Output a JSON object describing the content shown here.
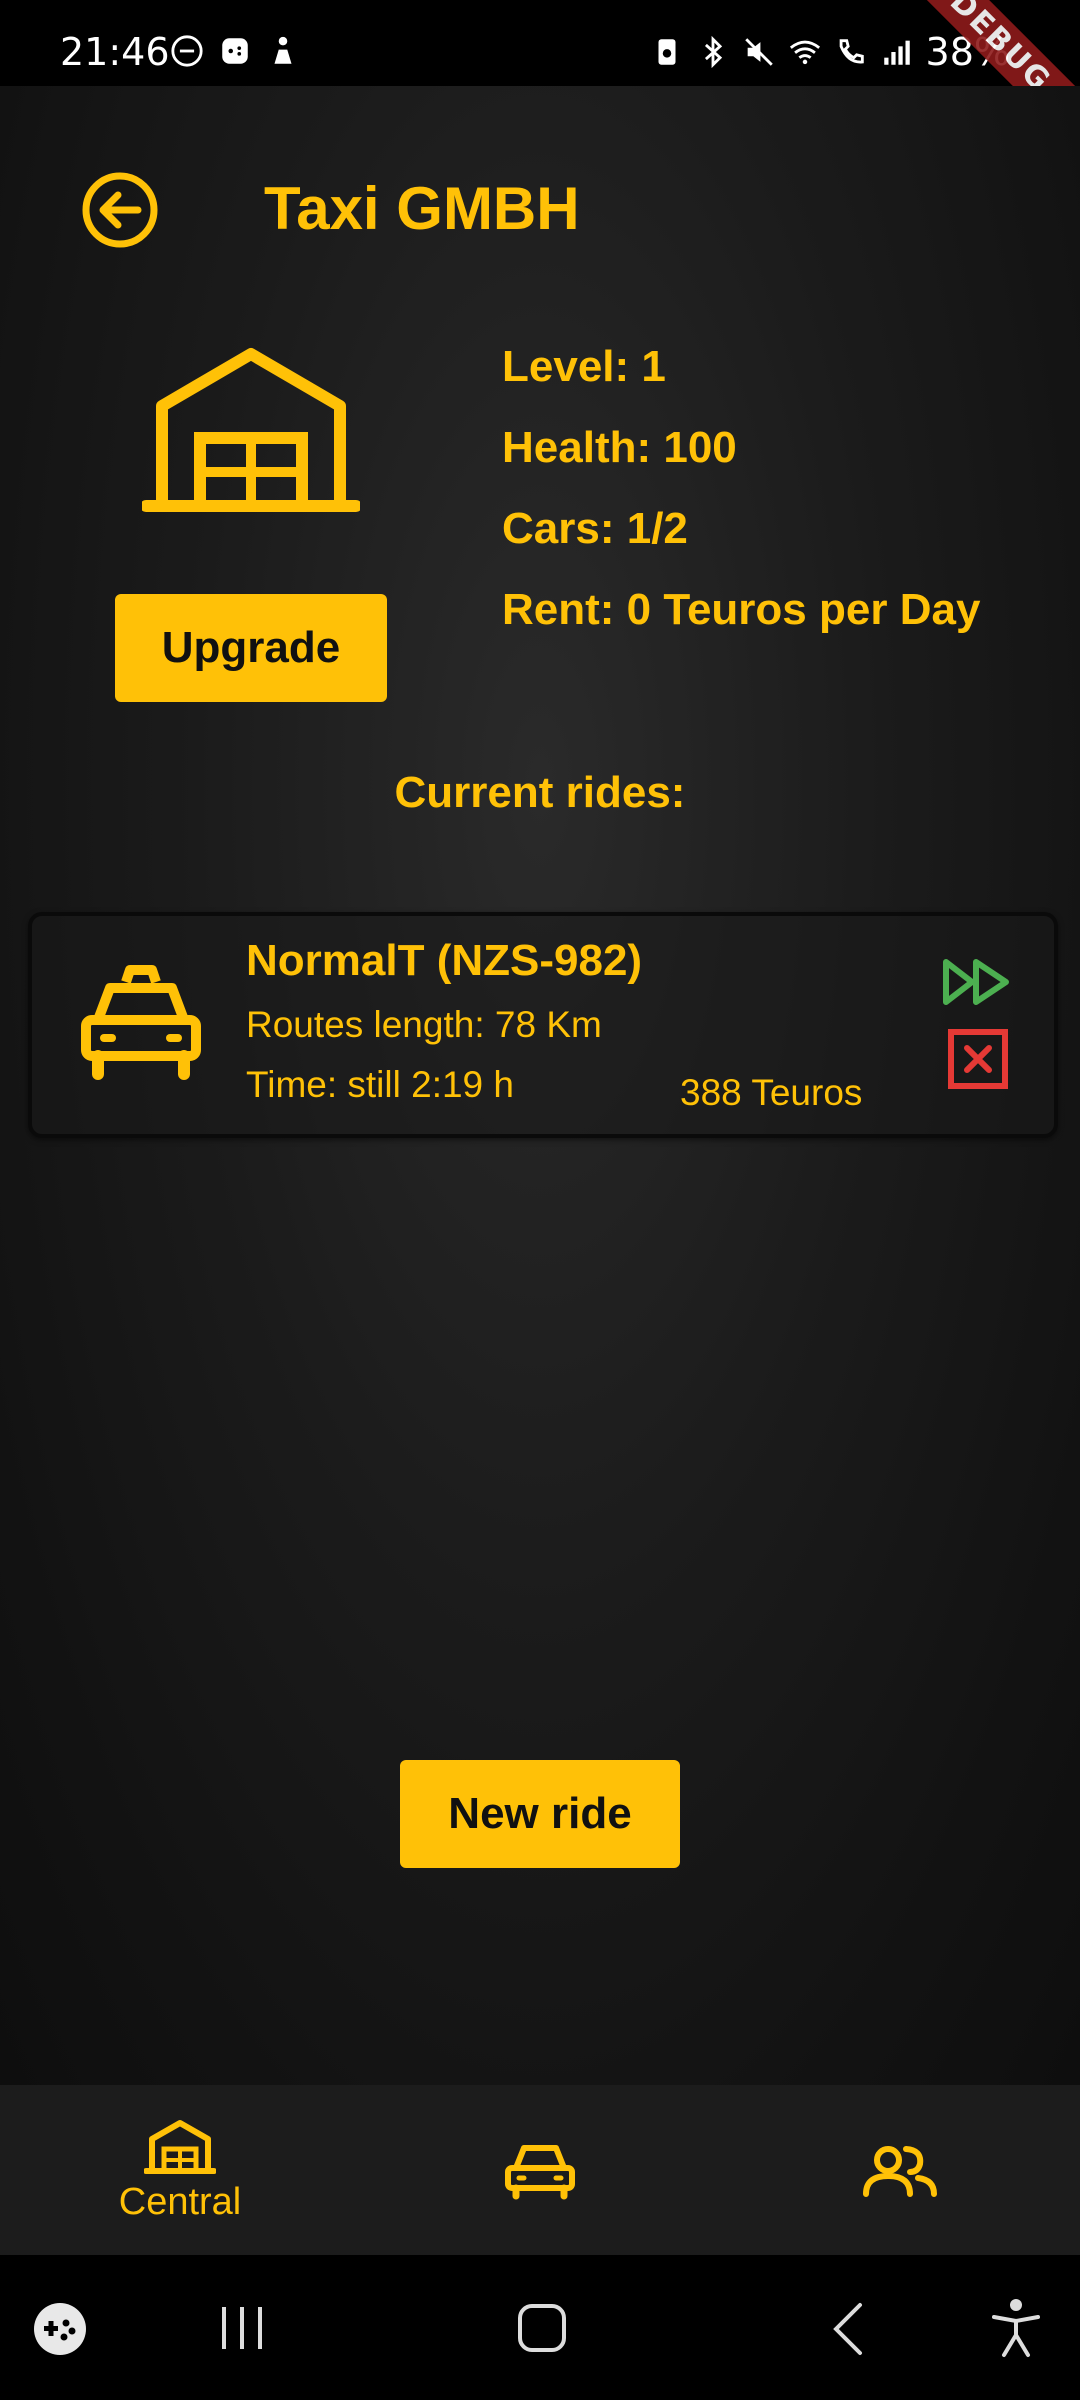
{
  "status_bar": {
    "time": "21:46",
    "battery": "38%",
    "left_icons": [
      "do-not-disturb-icon",
      "game-launcher-icon",
      "gesture-icon"
    ],
    "right_icons": [
      "data-saver-icon",
      "bluetooth-icon",
      "mute-icon",
      "wifi-icon",
      "wifi-call-icon",
      "signal-icon"
    ],
    "debug_label": "DEBUG"
  },
  "header": {
    "title": "Taxi GMBH",
    "back_icon": "back-arrow-circle-icon"
  },
  "garage": {
    "icon": "garage-icon",
    "upgrade_label": "Upgrade",
    "stats": {
      "level": "Level: 1",
      "health": "Health: 100",
      "cars": "Cars: 1/2",
      "rent": "Rent: 0 Teuros per Day"
    }
  },
  "rides": {
    "heading": "Current rides:",
    "items": [
      {
        "icon": "taxi-icon",
        "name": "NormalT (NZS-982)",
        "route": "Routes length: 78 Km",
        "time": "Time: still 2:19 h",
        "price": "388 Teuros"
      }
    ]
  },
  "actions": {
    "new_ride_label": "New ride"
  },
  "bottom_nav": {
    "items": [
      {
        "label": "Central",
        "icon": "garage-icon"
      },
      {
        "label": "",
        "icon": "car-icon"
      },
      {
        "label": "",
        "icon": "people-icon"
      }
    ]
  },
  "system_nav": {
    "items": [
      "game-tools-icon",
      "recent-apps-icon",
      "home-icon",
      "back-icon",
      "accessibility-icon"
    ]
  },
  "colors": {
    "accent": "#FFC107",
    "background": "#1b1b1b",
    "fast_forward": "#4CAF50",
    "cancel": "#E53935"
  }
}
